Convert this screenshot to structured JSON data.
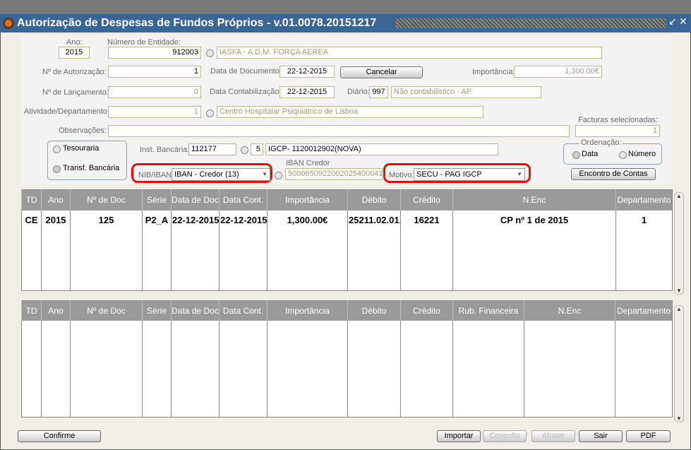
{
  "window": {
    "title": "Autorização de Despesas de Fundos Próprios - v.01.0078.20151217",
    "minimize": "↙",
    "close": "✕"
  },
  "form": {
    "ano_label": "Ano:",
    "ano": "2015",
    "entidade_label": "Número de Entidade:",
    "entidade": "912003",
    "entidade_nome": "IASFA - A.D.M. FORÇA AEREA",
    "autorizacao_label": "Nº de Autorização:",
    "autorizacao": "1",
    "data_doc_label": "Data de Documento:",
    "data_doc": "22-12-2015",
    "cancelar": "Cancelar",
    "importancia_label": "Importância:",
    "importancia": "1,300.00€",
    "lancamento_label": "Nº de Lançamento:",
    "lancamento": "0",
    "data_contab_label": "Data Contabilização:",
    "data_contab": "22-12-2015",
    "diario_label": "Diário:",
    "diario": "997",
    "diario_nome": "Não contabilistico - AP",
    "atividade_label": "Atividade/Departamento:",
    "atividade": "1",
    "atividade_nome": "Centro Hospitalar Psiquiátrico de Lisboa",
    "observacoes_label": "Observações:",
    "observacoes": "",
    "facturas_label": "Facturas selecionadas:",
    "facturas": "1",
    "tesouraria": "Tesouraria",
    "transf": "Transf. Bancária",
    "inst_label": "Inst. Bancária:",
    "inst": "112177",
    "inst_num": "5",
    "inst_nome": "IGCP- 1120012902(NOVA)",
    "iban_credor_label": "IBAN  Credor",
    "iban_credor": "5000650922002025400041",
    "nib_label": "NIB/IBAN",
    "nib": "IBAN - Credor (13)",
    "motivo_label": "Motivo:",
    "motivo": "SECU - PAG IGCP",
    "ordenacao_label": "Ordenação:",
    "ord_data": "Data",
    "ord_numero": "Número",
    "encontro": "Encontro de Contas",
    "highlight_color": "#e01010"
  },
  "table1": {
    "headers": [
      "TD",
      "Ano",
      "Nº de Doc",
      "Série",
      "Data de Doc.",
      "Data Cont.",
      "Importância",
      "Débito",
      "Crédito",
      "N.Enc",
      "Departamento"
    ],
    "rows": [
      [
        "CE",
        "2015",
        "125",
        "P2_A",
        "22-12-2015",
        "22-12-2015",
        "1,300.00€",
        "25211.02.01.",
        "16221",
        "CP nº 1 de 2015",
        "1"
      ]
    ]
  },
  "table2": {
    "headers": [
      "TD",
      "Ano",
      "Nº de Doc",
      "Série",
      "Data de Doc",
      "Data Cont.",
      "Importância",
      "Débito",
      "Crédito",
      "Rub. Financeira",
      "N.Enc",
      "Departamento"
    ],
    "rows": []
  },
  "buttons": {
    "confirme": "Confirme",
    "importar": "Importar",
    "consulta": "Consulta",
    "abater": "Abater",
    "sair": "Sair",
    "pdf": "PDF"
  }
}
